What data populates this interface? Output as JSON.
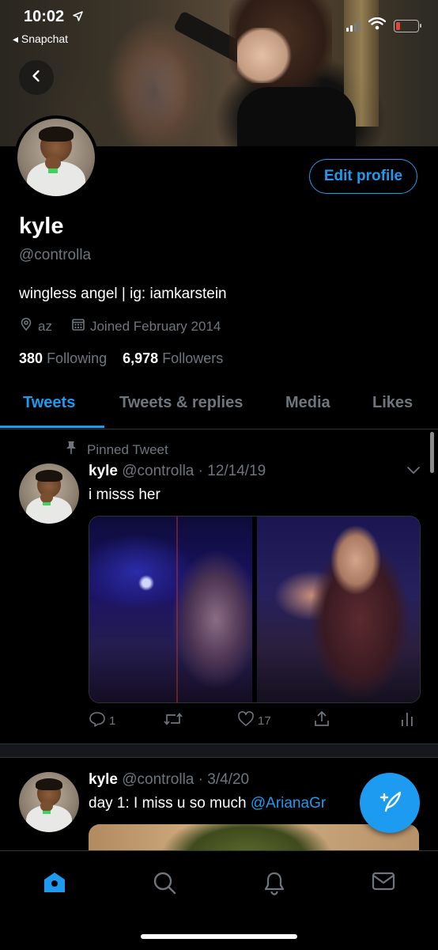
{
  "status_bar": {
    "time": "10:02",
    "back_app": "◂ Snapchat"
  },
  "profile": {
    "name": "kyle",
    "handle": "@controlla",
    "bio": "wingless angel | ig: iamkarstein",
    "location": "az",
    "joined": "Joined February 2014",
    "following_count": "380",
    "following_label": "Following",
    "followers_count": "6,978",
    "followers_label": "Followers",
    "edit_label": "Edit profile"
  },
  "tabs": [
    {
      "label": "Tweets",
      "active": true
    },
    {
      "label": "Tweets & replies",
      "active": false
    },
    {
      "label": "Media",
      "active": false
    },
    {
      "label": "Likes",
      "active": false
    }
  ],
  "tweets": [
    {
      "pinned_label": "Pinned Tweet",
      "name": "kyle",
      "handle": "@controlla",
      "date": "· 12/14/19",
      "text": "i misss her",
      "replies": "1",
      "likes": "17"
    },
    {
      "name": "kyle",
      "handle": "@controlla",
      "date": "· 3/4/20",
      "text": "day 1: I miss u so much ",
      "mention": "@ArianaGr"
    }
  ],
  "icons": {
    "back": "chevron-left-icon",
    "location": "location-pin-icon",
    "calendar": "calendar-icon",
    "pin": "pin-icon",
    "reply": "reply-icon",
    "retweet": "retweet-icon",
    "like": "heart-icon",
    "share": "share-icon",
    "analytics": "analytics-icon",
    "compose": "compose-tweet-icon",
    "nav_home": "home-icon",
    "nav_search": "search-icon",
    "nav_notifications": "bell-icon",
    "nav_messages": "mail-icon"
  },
  "colors": {
    "accent": "#1d9bf0",
    "muted": "#6e767d",
    "background": "#000000"
  }
}
